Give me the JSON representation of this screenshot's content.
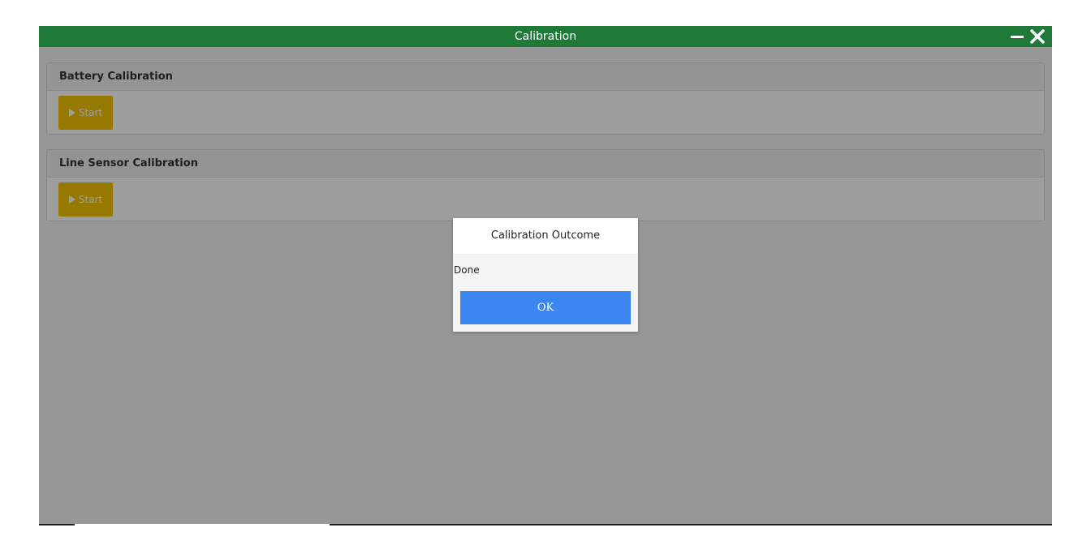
{
  "window": {
    "title": "Calibration",
    "controls": {
      "minimize_icon": "minimize-icon",
      "close_icon": "close-icon"
    }
  },
  "panels": [
    {
      "title": "Battery Calibration",
      "button": {
        "icon": "play-icon",
        "label": "Start"
      }
    },
    {
      "title": "Line Sensor Calibration",
      "button": {
        "icon": "play-icon",
        "label": "Start"
      }
    }
  ],
  "dialog": {
    "title": "Calibration Outcome",
    "message": "Done",
    "ok_label": "OK"
  },
  "colors": {
    "titlebar": "#1f7a3a",
    "start_button": "#f5c400",
    "ok_button": "#3b86f1"
  }
}
